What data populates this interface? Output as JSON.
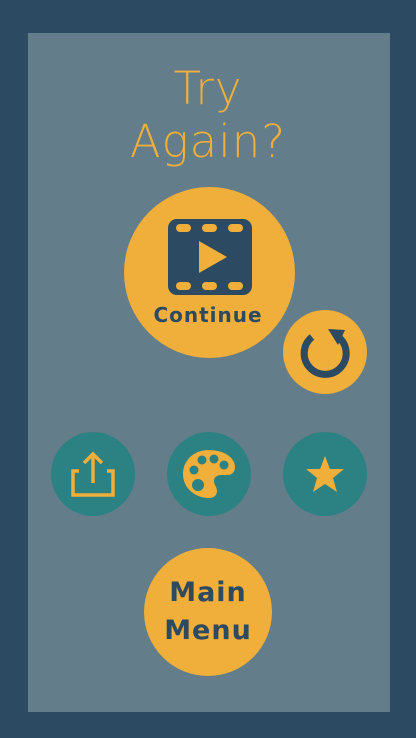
{
  "title": {
    "line1": "Try",
    "line2": "Again?"
  },
  "buttons": {
    "continue_label": "Continue",
    "continue_icon": "video-play-icon",
    "restart_icon": "restart-icon",
    "share_icon": "share-icon",
    "palette_icon": "palette-icon",
    "star_icon": "star-icon",
    "main_menu_line1": "Main",
    "main_menu_line2": "Menu"
  },
  "colors": {
    "frame": "#2c4a61",
    "panel": "#637d8a",
    "accent": "#f0ae3a",
    "teal": "#2c8282"
  }
}
